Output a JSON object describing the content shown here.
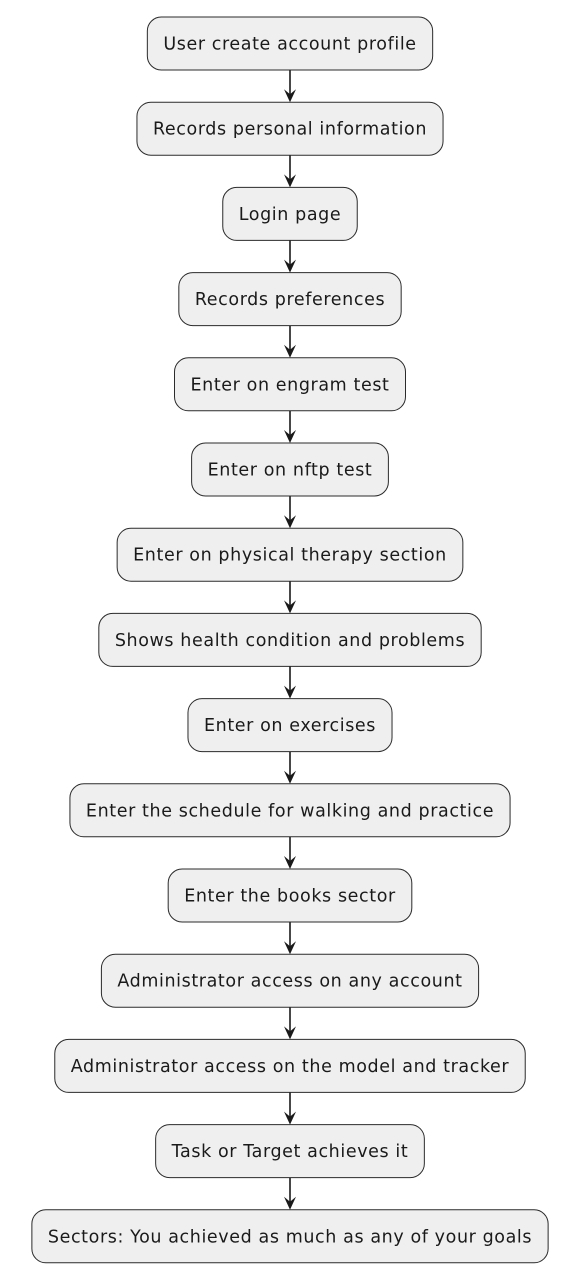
{
  "flow": {
    "steps": [
      {
        "label": "User create account profile"
      },
      {
        "label": "Records personal information"
      },
      {
        "label": "Login page"
      },
      {
        "label": "Records preferences"
      },
      {
        "label": "Enter on engram test"
      },
      {
        "label": "Enter on nftp test"
      },
      {
        "label": "Enter on physical therapy section"
      },
      {
        "label": "Shows health condition and problems"
      },
      {
        "label": "Enter on exercises"
      },
      {
        "label": "Enter the schedule for walking and practice"
      },
      {
        "label": "Enter the books sector"
      },
      {
        "label": "Administrator access on any account"
      },
      {
        "label": "Administrator access on the model and tracker"
      },
      {
        "label": "Task or Target achieves it"
      },
      {
        "label": "Sectors: You achieved as much as any of your goals"
      }
    ]
  },
  "colors": {
    "node_fill": "#efefef",
    "node_stroke": "#2b2b2b",
    "arrow": "#1a1a1a",
    "text": "#1a1a1a",
    "background": "#ffffff"
  }
}
